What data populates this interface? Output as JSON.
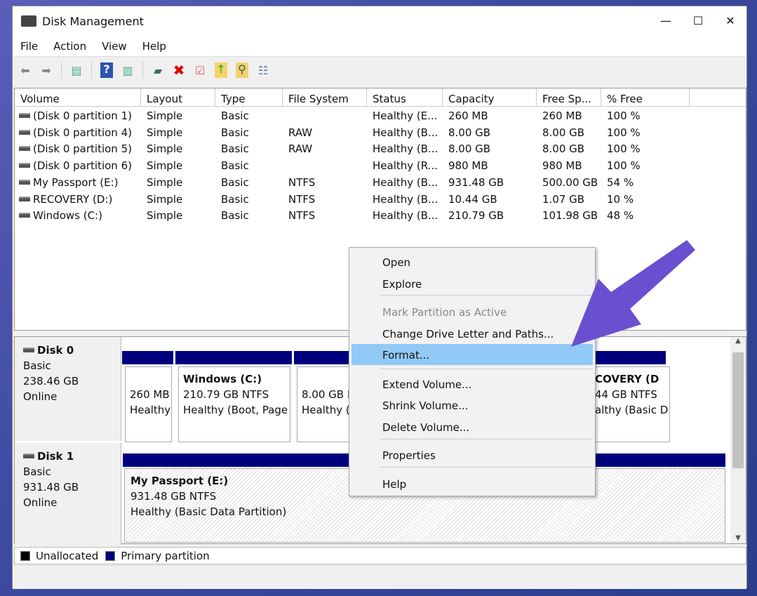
{
  "window": {
    "title": "Disk Management",
    "minimize": "—",
    "maximize": "☐",
    "close": "✕"
  },
  "menu": [
    "File",
    "Action",
    "View",
    "Help"
  ],
  "toolbar": [
    "back-icon",
    "forward-icon",
    "console-tree-icon",
    "help-icon",
    "action-pane-icon",
    "connect-drive-icon",
    "delete-icon",
    "check-icon",
    "folder-up-icon",
    "folder-search-icon",
    "properties-list-icon"
  ],
  "columns": [
    "Volume",
    "Layout",
    "Type",
    "File System",
    "Status",
    "Capacity",
    "Free Sp...",
    "% Free"
  ],
  "rows": [
    [
      "(Disk 0 partition 1)",
      "Simple",
      "Basic",
      "",
      "Healthy (E...",
      "260 MB",
      "260 MB",
      "100 %"
    ],
    [
      "(Disk 0 partition 4)",
      "Simple",
      "Basic",
      "RAW",
      "Healthy (B...",
      "8.00 GB",
      "8.00 GB",
      "100 %"
    ],
    [
      "(Disk 0 partition 5)",
      "Simple",
      "Basic",
      "RAW",
      "Healthy (B...",
      "8.00 GB",
      "8.00 GB",
      "100 %"
    ],
    [
      "(Disk 0 partition 6)",
      "Simple",
      "Basic",
      "",
      "Healthy (R...",
      "980 MB",
      "980 MB",
      "100 %"
    ],
    [
      "My Passport (E:)",
      "Simple",
      "Basic",
      "NTFS",
      "Healthy (B...",
      "931.48 GB",
      "500.00 GB",
      "54 %"
    ],
    [
      "RECOVERY (D:)",
      "Simple",
      "Basic",
      "NTFS",
      "Healthy (B...",
      "10.44 GB",
      "1.07 GB",
      "10 %"
    ],
    [
      "Windows (C:)",
      "Simple",
      "Basic",
      "NTFS",
      "Healthy (B...",
      "210.79 GB",
      "101.98 GB",
      "48 %"
    ]
  ],
  "disks": [
    {
      "name": "Disk 0",
      "type": "Basic",
      "size": "238.46 GB",
      "state": "Online",
      "partitions": [
        {
          "name": "",
          "line1": "260 MB",
          "line2": "Healthy"
        },
        {
          "name": "Windows  (C:)",
          "line1": "210.79 GB NTFS",
          "line2": "Healthy (Boot, Page"
        },
        {
          "name": "",
          "line1": "8.00 GB R",
          "line2": "Healthy ("
        },
        {
          "name": "COVERY  (D",
          "line1": "44 GB NTFS",
          "line2": "althy (Basic D"
        }
      ]
    },
    {
      "name": "Disk 1",
      "type": "Basic",
      "size": "931.48 GB",
      "state": "Online",
      "partitions": [
        {
          "name": "My Passport  (E:)",
          "line1": "931.48 GB NTFS",
          "line2": "Healthy (Basic Data Partition)"
        }
      ]
    }
  ],
  "legend": [
    {
      "label": "Unallocated",
      "color": "#000000"
    },
    {
      "label": "Primary partition",
      "color": "#00007f"
    }
  ],
  "context_menu": [
    {
      "label": "Open"
    },
    {
      "label": "Explore"
    },
    {
      "label": "Mark Partition as Active",
      "disabled": true
    },
    {
      "label": "Change Drive Letter and Paths..."
    },
    {
      "label": "Format...",
      "highlighted": true
    },
    {
      "label": "Extend Volume..."
    },
    {
      "label": "Shrink Volume..."
    },
    {
      "label": "Delete Volume..."
    },
    {
      "label": "Properties"
    },
    {
      "label": "Help"
    }
  ],
  "annotation": {
    "arrow_color": "#6a4fd0"
  }
}
